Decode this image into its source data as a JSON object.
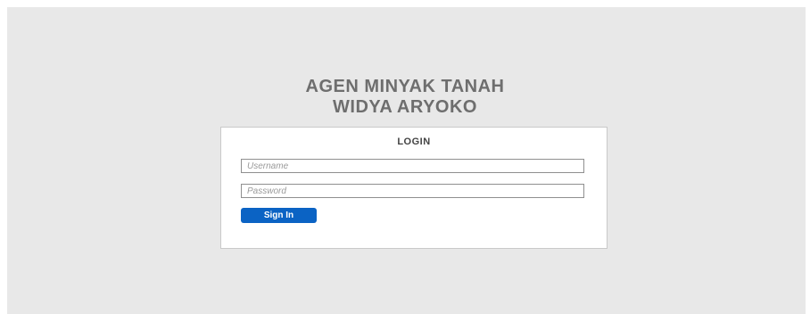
{
  "app": {
    "title_line1": "AGEN MINYAK TANAH",
    "title_line2": "WIDYA ARYOKO"
  },
  "login": {
    "heading": "LOGIN",
    "username": {
      "value": "",
      "placeholder": "Username"
    },
    "password": {
      "value": "",
      "placeholder": "Password"
    },
    "submit_label": "Sign In"
  },
  "colors": {
    "background": "#e8e8e8",
    "card": "#ffffff",
    "title_text": "#6e6e6e",
    "button": "#0b63c4",
    "button_text": "#ffffff"
  }
}
